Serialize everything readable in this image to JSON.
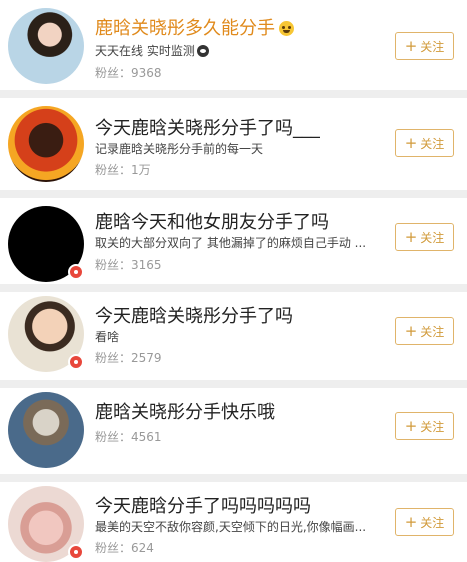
{
  "follow_label": "关注",
  "plus_glyph": "+",
  "accent_color": "#e08a1c",
  "items": [
    {
      "name": "鹿晗关晓彤多久能分手",
      "desc": "天天在线 实时监测",
      "fans": "粉丝：9368",
      "name_icon": "cry-emoji-icon",
      "desc_icon": "eye-icon"
    },
    {
      "name": "今天鹿晗关晓彤分手了吗___",
      "desc": "记录鹿晗关晓彤分手前的每一天",
      "fans": "粉丝：1万"
    },
    {
      "name": "鹿晗今天和他女朋友分手了吗",
      "desc": "取关的大部分双向了 其他漏掉了的麻烦自己手动 ...",
      "fans": "粉丝：3165"
    },
    {
      "name": "今天鹿晗关晓彤分手了吗",
      "desc": "看啥",
      "fans": "粉丝：2579"
    },
    {
      "name": "鹿晗关晓彤分手快乐哦",
      "fans": "粉丝：4561"
    },
    {
      "name": "今天鹿晗分手了吗吗吗吗吗",
      "desc": "最美的天空不敌你容颜,天空倾下的日光,你像幅画...",
      "fans": "粉丝：624"
    }
  ]
}
